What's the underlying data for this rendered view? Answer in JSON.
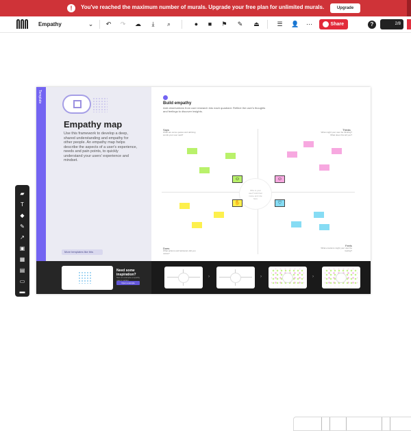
{
  "banner": {
    "message": "You've reached the maximum number of murals. Upgrade your free plan for unlimited murals.",
    "upgrade_label": "Upgrade",
    "bg_color": "#cf3338"
  },
  "toolbar": {
    "mural_title": "Empathy",
    "share_label": "Share",
    "timer_label": "2/8",
    "help_label": "?",
    "share_color": "#e22a3a"
  },
  "board": {
    "side_tab": "Template",
    "template_title": "Empathy map",
    "template_description": "Use this framework to develop a deep, shared understanding and empathy for other people. An empathy map helps describe the aspects of a user's experience, needs and pain points, to quickly understand your users' experience and mindset.",
    "template_button": "More templates like this",
    "step_title": "Build empathy",
    "step_description": "Add observations from user research into each quadrant. Reflect the user's thoughts and feelings to discover insights.",
    "quadrants": [
      {
        "label": "Says",
        "desc": "What are some quotes and defining words your user said?"
      },
      {
        "label": "Thinks",
        "desc": "What might your user be thinking? What does this tell you?"
      },
      {
        "label": "Does",
        "desc": "What actions and behaviors did you notice?"
      },
      {
        "label": "Feels",
        "desc": "What emotions might your user be feeling?"
      }
    ],
    "center_text": "Who is your user? Add their name and role here",
    "learn_title": "Need some inspiration?",
    "learn_sub": "See an example empathy map in action",
    "learn_button": "Open example",
    "accent_color": "#7364f2"
  },
  "icons": {
    "left_toolbar": [
      "sticky-note-icon",
      "text-icon",
      "shapes-icon",
      "pen-icon",
      "connector-icon",
      "image-icon",
      "grid-icon",
      "table-icon",
      "frame-icon",
      "upload-icon"
    ]
  }
}
